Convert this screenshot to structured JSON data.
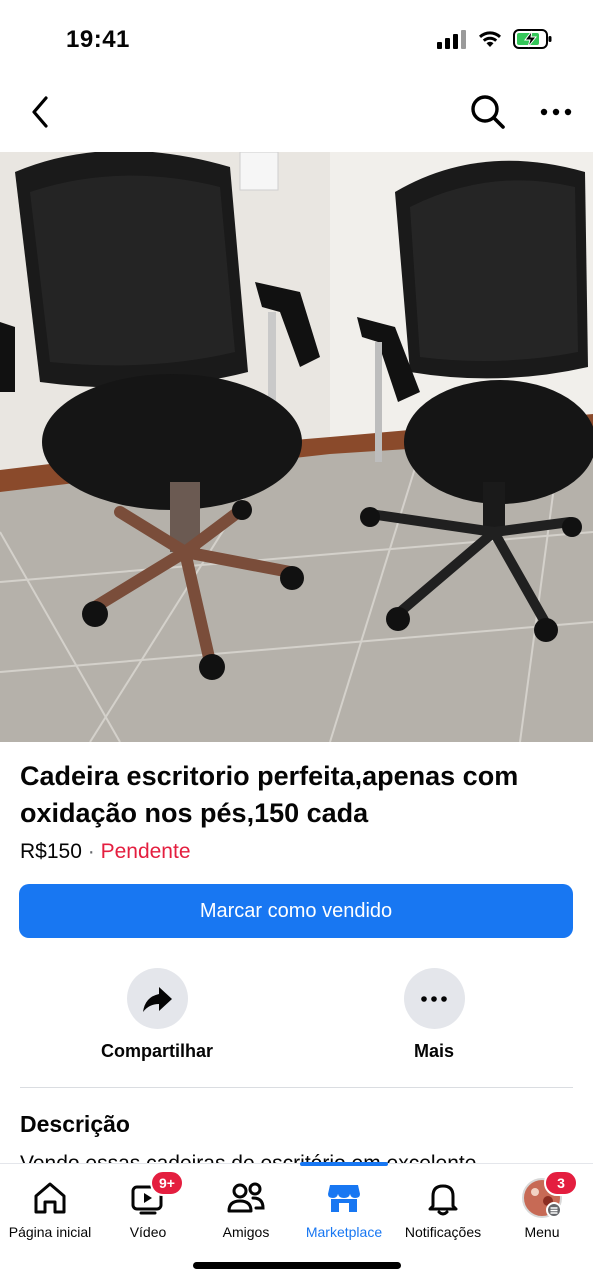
{
  "status_bar": {
    "time": "19:41"
  },
  "nav": {
    "back_icon": "chevron-left-icon",
    "search_icon": "search-icon",
    "more_icon": "ellipsis-icon"
  },
  "listing": {
    "photo_alt": "",
    "title": "Cadeira escritorio perfeita,apenas com oxidação nos pés,150 cada",
    "price": "R$150",
    "separator": "·",
    "status": "Pendente",
    "status_color": "#e41e3f"
  },
  "primary_action": {
    "label": "Marcar como vendido",
    "color": "#1877f2"
  },
  "actions": [
    {
      "label": "Compartilhar",
      "icon": "share-icon"
    },
    {
      "label": "Mais",
      "icon": "ellipsis-icon"
    }
  ],
  "description": {
    "heading": "Descrição",
    "text": "Vendo essas cadeiras de escritório em excelente"
  },
  "tab_bar": {
    "tabs": [
      {
        "label": "Página inicial",
        "icon": "home-icon"
      },
      {
        "label": "Vídeo",
        "icon": "video-icon",
        "badge": "9+"
      },
      {
        "label": "Amigos",
        "icon": "friends-icon"
      },
      {
        "label": "Marketplace",
        "icon": "marketplace-icon",
        "active": true
      },
      {
        "label": "Notificações",
        "icon": "bell-icon"
      },
      {
        "label": "Menu",
        "icon": "avatar-icon",
        "badge": "3"
      }
    ]
  }
}
